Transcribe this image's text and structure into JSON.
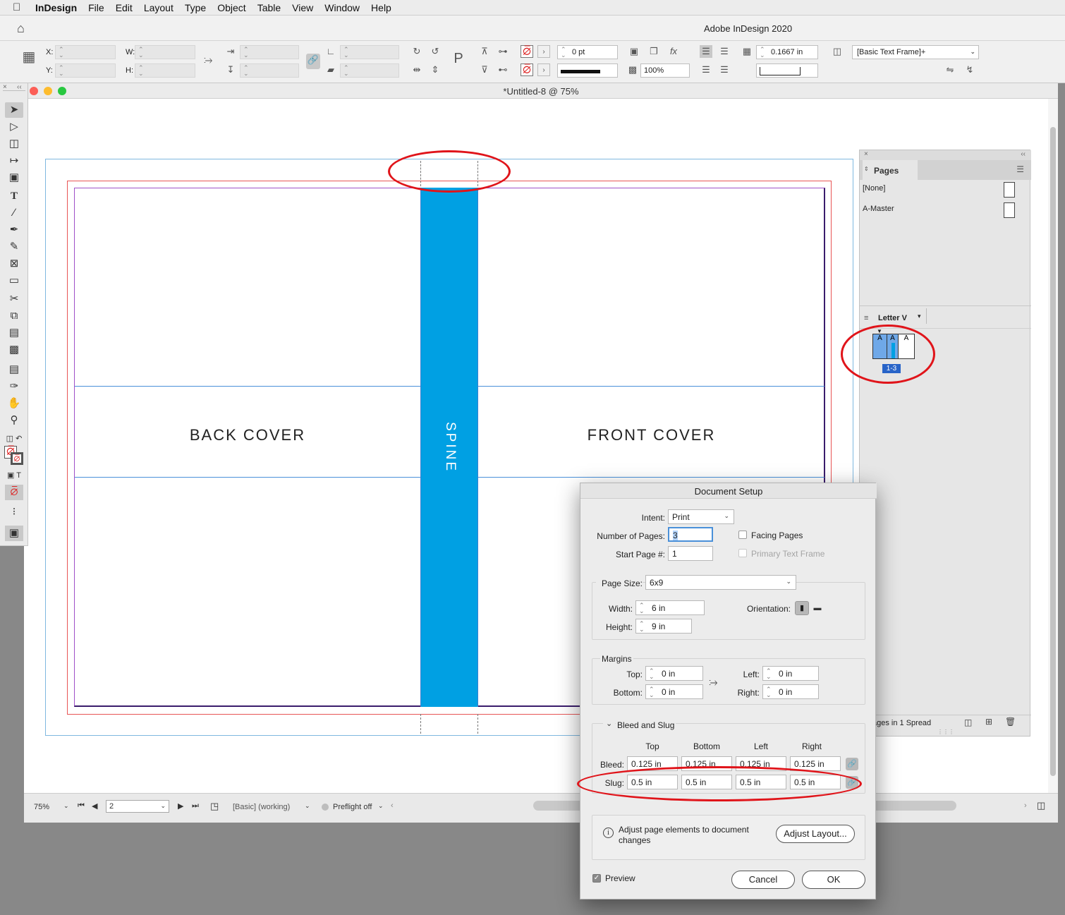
{
  "menubar": {
    "apple_icon": "apple-icon",
    "app": "InDesign",
    "items": [
      "File",
      "Edit",
      "Layout",
      "Type",
      "Object",
      "Table",
      "View",
      "Window",
      "Help"
    ]
  },
  "app_title": "Adobe InDesign 2020",
  "control": {
    "x_label": "X:",
    "y_label": "Y:",
    "w_label": "W:",
    "h_label": "H:",
    "stroke_weight": "0 pt",
    "opacity": "100%",
    "frame_fitting_value": "0.1667 in",
    "object_style": "[Basic Text Frame]+"
  },
  "document": {
    "title": "*Untitled-8 @ 75%",
    "back_cover": "BACK COVER",
    "front_cover": "FRONT COVER",
    "spine": "SPINE",
    "spine_color": "#00a0e3"
  },
  "status": {
    "zoom": "75%",
    "page": "2",
    "profile": "[Basic] (working)",
    "preflight": "Preflight off"
  },
  "pages_panel": {
    "tab": "Pages",
    "masters": [
      "[None]",
      "A-Master"
    ],
    "page_size": "Letter V",
    "spread_pages": [
      "A",
      "A",
      "A"
    ],
    "spread_label": "1-3",
    "footer": "ages in 1 Spread"
  },
  "dialog": {
    "title": "Document Setup",
    "intent_label": "Intent:",
    "intent_value": "Print",
    "num_pages_label": "Number of Pages:",
    "num_pages_value": "3",
    "start_page_label": "Start Page #:",
    "start_page_value": "1",
    "facing_pages": "Facing Pages",
    "primary_text_frame": "Primary Text Frame",
    "page_size_label": "Page Size:",
    "page_size_value": "6x9",
    "width_label": "Width:",
    "width_value": "6 in",
    "height_label": "Height:",
    "height_value": "9 in",
    "orientation_label": "Orientation:",
    "margins_title": "Margins",
    "top_label": "Top:",
    "top_value": "0 in",
    "bottom_label": "Bottom:",
    "bottom_value": "0 in",
    "left_label": "Left:",
    "left_value": "0 in",
    "right_label": "Right:",
    "right_value": "0 in",
    "bleed_slug_title": "Bleed and Slug",
    "col_top": "Top",
    "col_bottom": "Bottom",
    "col_left": "Left",
    "col_right": "Right",
    "bleed_label": "Bleed:",
    "bleed_values": [
      "0.125 in",
      "0.125 in",
      "0.125 in",
      "0.125 in"
    ],
    "slug_label": "Slug:",
    "slug_values": [
      "0.5 in",
      "0.5 in",
      "0.5 in",
      "0.5 in"
    ],
    "adjust_note": "Adjust page elements to document changes",
    "adjust_button": "Adjust Layout...",
    "preview": "Preview",
    "cancel": "Cancel",
    "ok": "OK"
  },
  "annotation_color": "#e0141a"
}
